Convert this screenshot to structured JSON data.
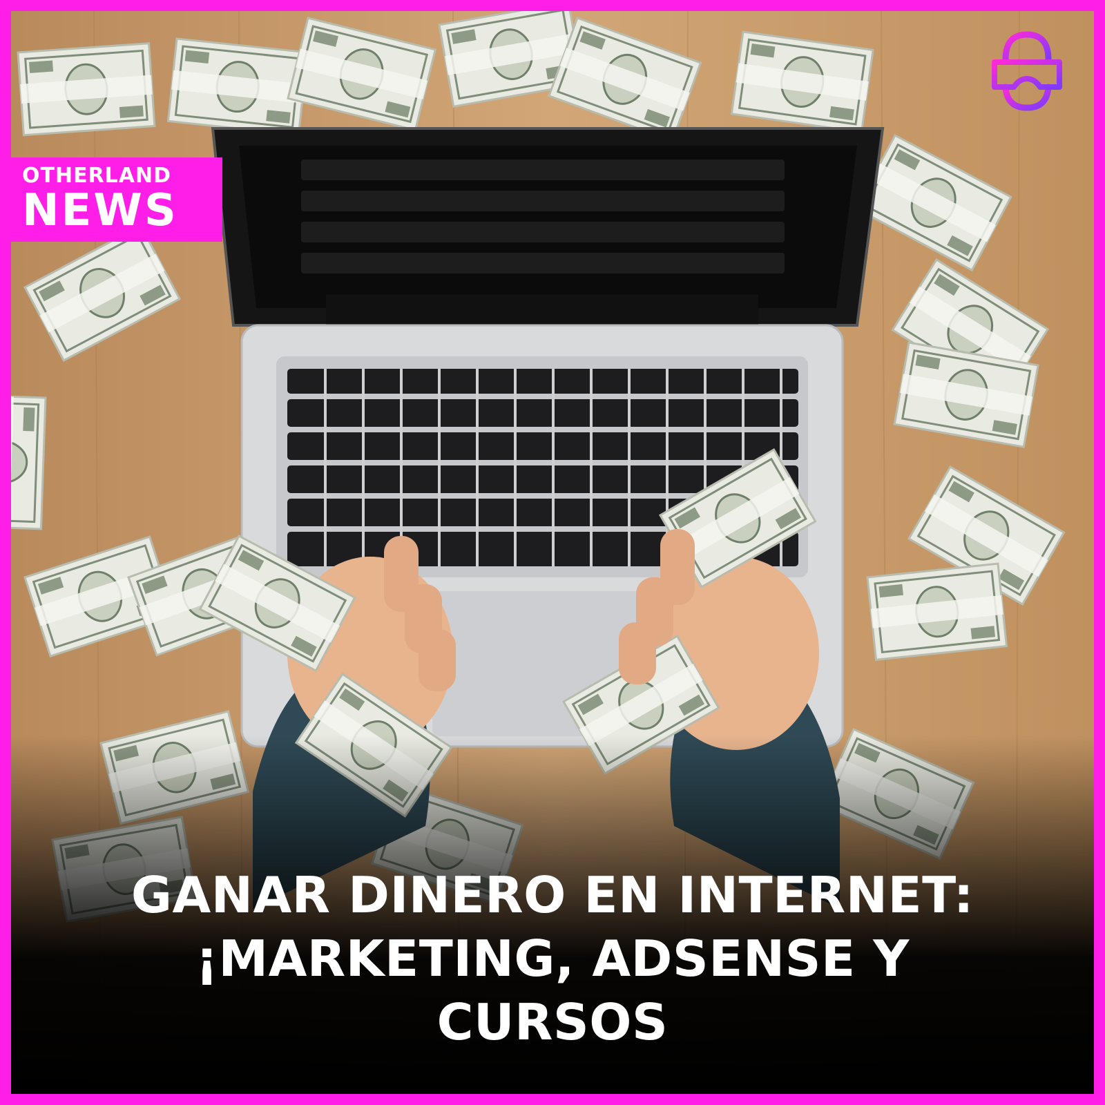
{
  "badge": {
    "line1": "OTHERLAND",
    "line2": "NEWS"
  },
  "logo": {
    "icon": "vr-headset-icon",
    "colors": [
      "#ff2ad6",
      "#7b3bff"
    ]
  },
  "headline": {
    "line1": "GANAR DINERO EN INTERNET:",
    "line2": "¡MARKETING, ADSENSE Y",
    "line3": "CURSOS"
  },
  "colors": {
    "frame": "#ff1ee8",
    "badge": "#ff1ee8",
    "text": "#ffffff",
    "desk": "#c89a6a"
  }
}
